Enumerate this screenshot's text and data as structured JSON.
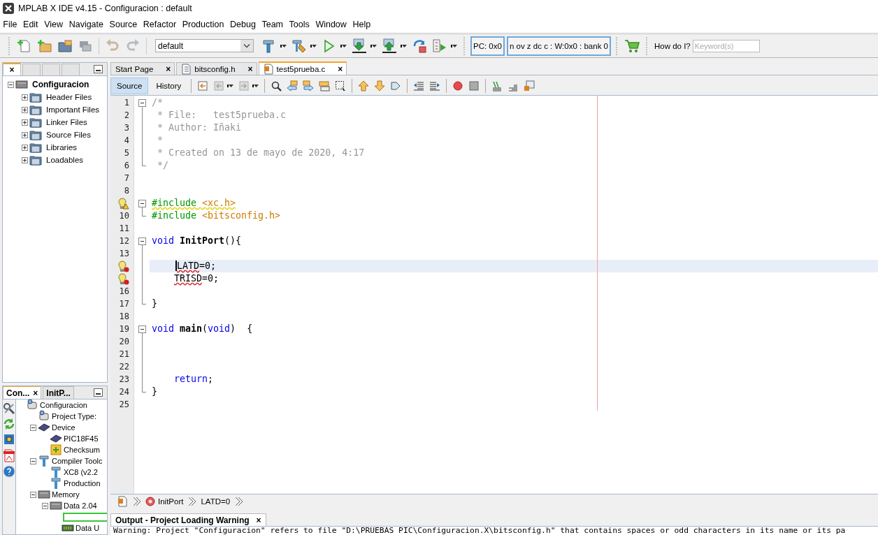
{
  "window": {
    "title": "MPLAB X IDE v4.15 - Configuracion : default"
  },
  "menu": [
    "File",
    "Edit",
    "View",
    "Navigate",
    "Source",
    "Refactor",
    "Production",
    "Debug",
    "Team",
    "Tools",
    "Window",
    "Help"
  ],
  "toolbar": {
    "configuration": "default",
    "pc": "PC: 0x0",
    "status": "n ov z dc c  : W:0x0 : bank 0",
    "help_label": "How do I?",
    "search": {
      "placeholder": "Keyword(s)"
    }
  },
  "project_pane": {
    "tabs": [
      {
        "close": "×",
        "selected": true
      },
      {
        "selected": false
      },
      {
        "selected": false
      },
      {
        "selected": false
      }
    ],
    "tree": {
      "label": "Configuracion",
      "expanded": true,
      "children": [
        {
          "label": "Header Files",
          "expanded": false
        },
        {
          "label": "Important Files",
          "expanded": false
        },
        {
          "label": "Linker Files",
          "expanded": false
        },
        {
          "label": "Source Files",
          "expanded": false
        },
        {
          "label": "Libraries",
          "expanded": false
        },
        {
          "label": "Loadables",
          "expanded": false
        }
      ]
    }
  },
  "dashboard": {
    "tabs": [
      {
        "label": "Con...",
        "close": "×",
        "selected": true
      },
      {
        "label": "InitP...",
        "selected": false
      }
    ],
    "tree": {
      "label": "Configuracion",
      "kind": "project",
      "children": [
        {
          "label": "Project Type:",
          "kind": "project"
        },
        {
          "label": "Device",
          "kind": "chip",
          "expanded": true,
          "children": [
            {
              "label": "PIC18F45",
              "kind": "chip"
            },
            {
              "label": "Checksum",
              "kind": "checksum"
            }
          ]
        },
        {
          "label": "Compiler Toolc",
          "kind": "tool",
          "expanded": true,
          "children": [
            {
              "label": "XC8 (v2.2",
              "kind": "tool"
            },
            {
              "label": "Production",
              "kind": "tool"
            }
          ]
        },
        {
          "label": "Memory",
          "kind": "memory",
          "expanded": true,
          "children": [
            {
              "label": "Data 2.04",
              "kind": "memory",
              "expanded": true,
              "children": [
                {
                  "kind": "bar"
                },
                {
                  "label": "Data U",
                  "kind": "ram"
                }
              ]
            }
          ]
        }
      ]
    }
  },
  "editor": {
    "tabs": [
      {
        "label": "Start Page",
        "close": "×",
        "selected": false
      },
      {
        "label": "bitsconfig.h",
        "close": "×",
        "selected": false
      },
      {
        "label": "test5prueba.c",
        "close": "×",
        "selected": true
      }
    ],
    "views": [
      {
        "label": "Source",
        "selected": true
      },
      {
        "label": "History",
        "selected": false
      }
    ],
    "lines": [
      {
        "number": "1",
        "fold_start": true,
        "tokens": [
          {
            "kind": "comment",
            "text": "/*"
          }
        ]
      },
      {
        "number": "2",
        "fold_guide": true,
        "tokens": [
          {
            "kind": "comment",
            "text": " * File:   test5prueba.c"
          }
        ]
      },
      {
        "number": "3",
        "fold_guide": true,
        "tokens": [
          {
            "kind": "comment",
            "text": " * Author: Iñaki"
          }
        ]
      },
      {
        "number": "4",
        "fold_guide": true,
        "tokens": [
          {
            "kind": "comment",
            "text": " *"
          }
        ]
      },
      {
        "number": "5",
        "fold_guide": true,
        "tokens": [
          {
            "kind": "comment",
            "text": " * Created on 13 de mayo de 2020, 4:17"
          }
        ]
      },
      {
        "number": "6",
        "fold_end": true,
        "tokens": [
          {
            "kind": "comment",
            "text": " */"
          }
        ]
      },
      {
        "number": "7"
      },
      {
        "number": "8"
      },
      {
        "warning": true,
        "fold_start": true,
        "tokens": [
          {
            "kind": "directive",
            "text": "#include",
            "warning_underline": true
          },
          {
            "kind": "header",
            "text": " <xc.h>",
            "warning_underline": true
          }
        ]
      },
      {
        "number": "10",
        "fold_end": true,
        "tokens": [
          {
            "kind": "directive",
            "text": "#include"
          },
          {
            "kind": "header",
            "text": " <bitsconfig.h>"
          }
        ]
      },
      {
        "number": "11"
      },
      {
        "number": "12",
        "fold_start": true,
        "tokens": [
          {
            "kind": "keyword",
            "text": "void "
          },
          {
            "kind": "bold",
            "text": "InitPort"
          },
          {
            "kind": "plain",
            "text": "(){"
          }
        ]
      },
      {
        "number": "13",
        "fold_guide": true
      },
      {
        "error": true,
        "fold_guide": true,
        "current": true,
        "indented": true,
        "tokens": [
          {
            "kind": "plain",
            "text": "LATD",
            "error_underline": true,
            "caret": true
          },
          {
            "kind": "plain",
            "text": "=0;"
          }
        ]
      },
      {
        "error": true,
        "fold_guide": true,
        "indented": true,
        "tokens": [
          {
            "kind": "plain",
            "text": "TRISD",
            "error_underline": true
          },
          {
            "kind": "plain",
            "text": "=0;"
          }
        ]
      },
      {
        "number": "16",
        "fold_guide": true
      },
      {
        "number": "17",
        "fold_end": true,
        "tokens": [
          {
            "kind": "plain",
            "text": "}"
          }
        ]
      },
      {
        "number": "18"
      },
      {
        "number": "19",
        "fold_start": true,
        "tokens": [
          {
            "kind": "keyword",
            "text": "void "
          },
          {
            "kind": "bold",
            "text": "main"
          },
          {
            "kind": "plain",
            "text": "("
          },
          {
            "kind": "keyword",
            "text": "void"
          },
          {
            "kind": "plain",
            "text": ")  {"
          }
        ]
      },
      {
        "number": "20",
        "fold_guide": true
      },
      {
        "number": "21",
        "fold_guide": true
      },
      {
        "number": "22",
        "fold_guide": true
      },
      {
        "number": "23",
        "fold_guide": true,
        "indented": true,
        "tokens": [
          {
            "kind": "keyword",
            "text": "return"
          },
          {
            "kind": "plain",
            "text": ";"
          }
        ]
      },
      {
        "number": "24",
        "fold_end": true,
        "tokens": [
          {
            "kind": "plain",
            "text": "}"
          }
        ]
      },
      {
        "number": "25"
      }
    ],
    "breadcrumb": [
      "InitPort",
      "LATD=0"
    ]
  },
  "output": {
    "title": "Output - Project Loading Warning",
    "close": "×",
    "text": "Warning: Project \"Configuracion\" refers to file \"D:\\PRUEBAS PIC\\Configuracion.X\\bitsconfig.h\" that contains spaces or odd characters in its name or its pa"
  }
}
